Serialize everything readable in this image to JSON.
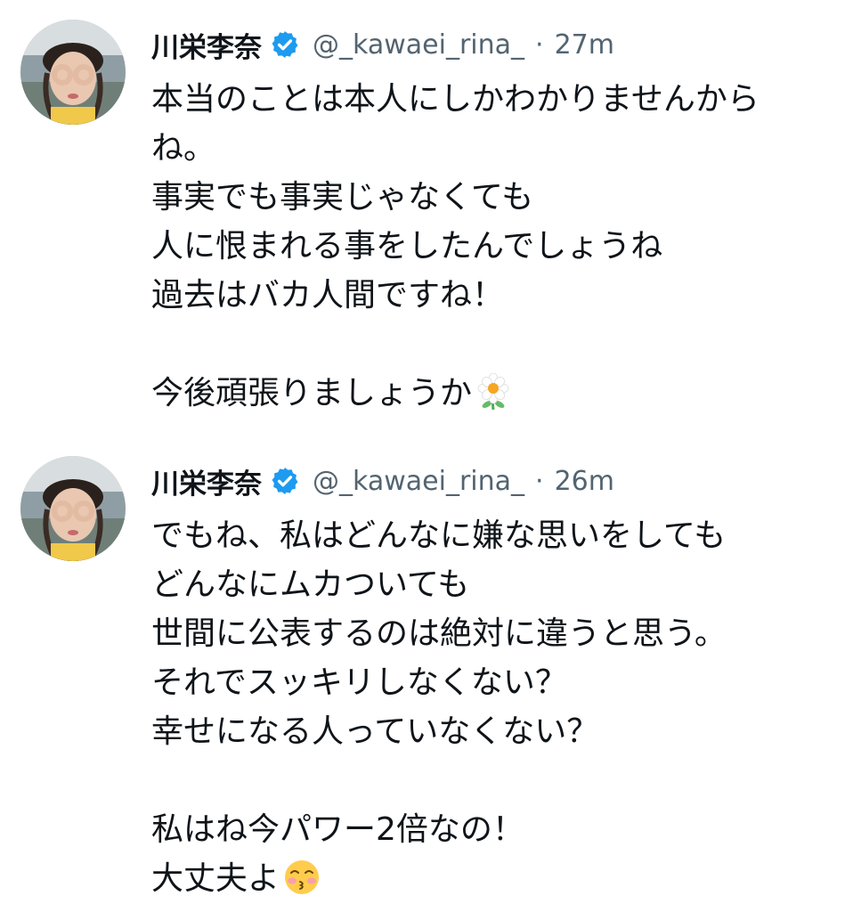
{
  "tweets": [
    {
      "name": "川栄李奈",
      "handle": "@_kawaei_rina_",
      "separator": "·",
      "time": "27m",
      "verified_icon": "verified-badge-icon",
      "lines": [
        "本当のことは本人にしかわかりませんから",
        "ね。",
        "事実でも事実じゃなくても",
        "人に恨まれる事をしたんでしょうね",
        "過去はバカ人間ですね！",
        "",
        "今後頑張りましょうか"
      ],
      "trailing_emoji": "blossom-emoji-icon"
    },
    {
      "name": "川栄李奈",
      "handle": "@_kawaei_rina_",
      "separator": "·",
      "time": "26m",
      "verified_icon": "verified-badge-icon",
      "lines": [
        "でもね、私はどんなに嫌な思いをしても",
        "どんなにムカついても",
        "世間に公表するのは絶対に違うと思う。",
        "それでスッキリしなくない？",
        "幸せになる人っていなくない？",
        "",
        "私はね今パワー2倍なの！",
        "大丈夫よ"
      ],
      "trailing_emoji": "kissing-face-emoji-icon"
    }
  ],
  "colors": {
    "text": "#0f1419",
    "secondary": "#536471",
    "verified": "#1d9bf0"
  }
}
